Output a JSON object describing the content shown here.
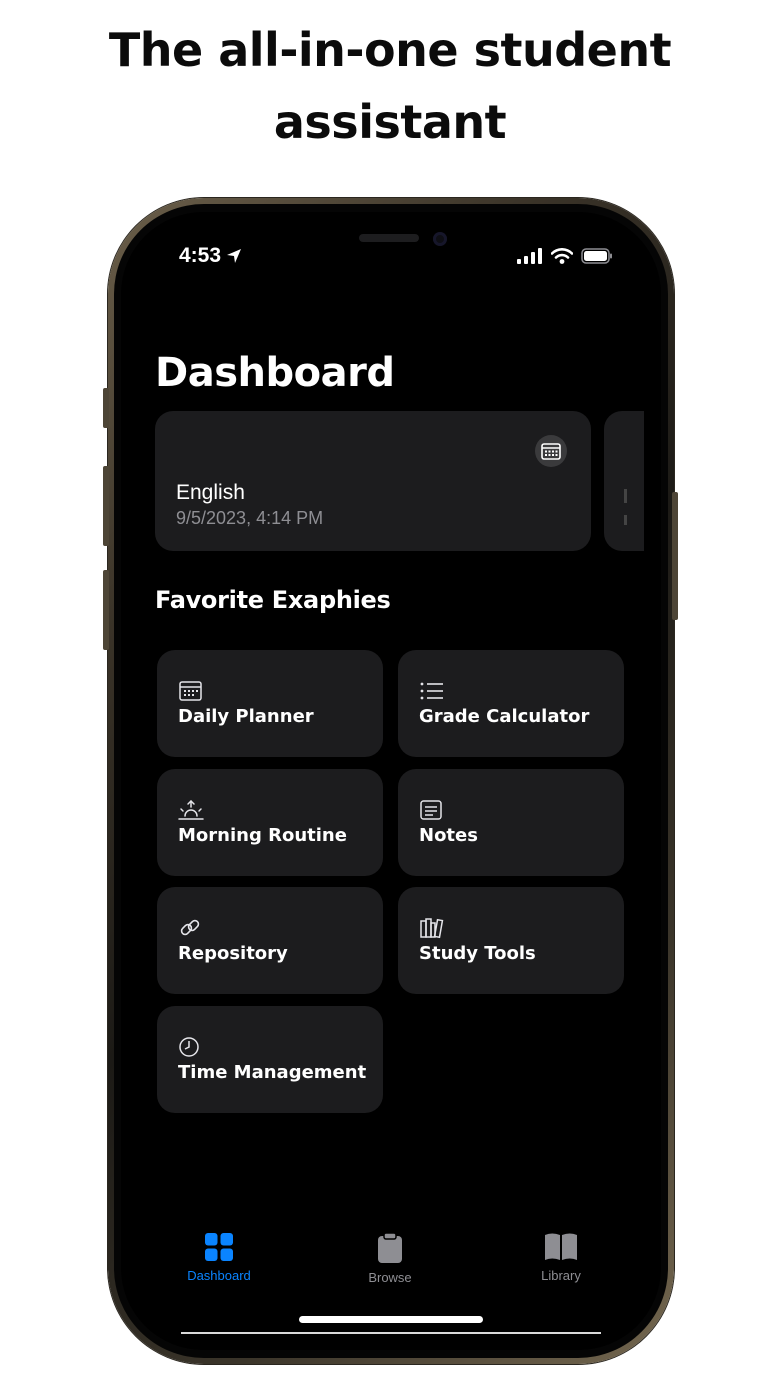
{
  "headline": {
    "line1": "The all-in-one student",
    "line2": "assistant"
  },
  "status_bar": {
    "time": "4:53"
  },
  "page_title": "Dashboard",
  "event_card": {
    "subject": "English",
    "datetime": "9/5/2023, 4:14 PM"
  },
  "section_title": "Favorite Exaphies",
  "favorites": [
    {
      "label": "Daily Planner",
      "icon": "calendar-icon"
    },
    {
      "label": "Grade Calculator",
      "icon": "checklist-icon"
    },
    {
      "label": "Morning Routine",
      "icon": "sunrise-icon"
    },
    {
      "label": "Notes",
      "icon": "note-icon"
    },
    {
      "label": "Repository",
      "icon": "link-icon"
    },
    {
      "label": "Study Tools",
      "icon": "books-icon"
    },
    {
      "label": "Time Management",
      "icon": "clock-icon"
    }
  ],
  "tabs": [
    {
      "label": "Dashboard",
      "icon": "grid-icon",
      "active": true
    },
    {
      "label": "Browse",
      "icon": "clipboard-icon",
      "active": false
    },
    {
      "label": "Library",
      "icon": "book-icon",
      "active": false
    }
  ],
  "colors": {
    "accent": "#0a84ff",
    "card": "#1c1c1e",
    "secondary_text": "#8e8e93"
  }
}
